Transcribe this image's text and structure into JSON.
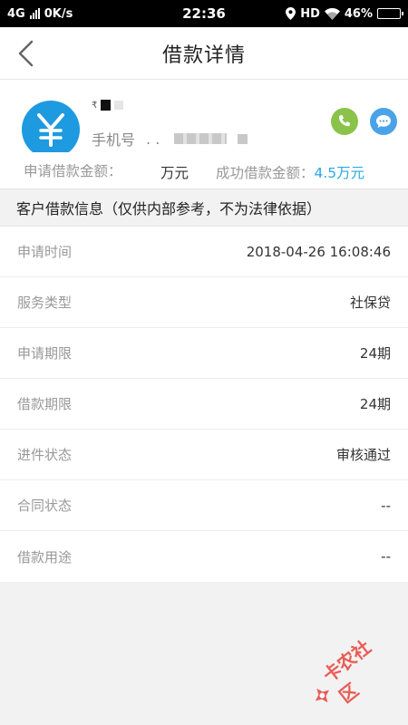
{
  "status": {
    "network": "4G",
    "speed": "0K/s",
    "time": "22:36",
    "hd": "HD",
    "battery": "46%"
  },
  "nav": {
    "title": "借款详情"
  },
  "profile": {
    "name_visible": "₹",
    "phone_label": "手机号",
    "phone_dots": ". ."
  },
  "amounts": {
    "applied_label": "申请借款金额：",
    "applied_value": "万元",
    "success_label": "成功借款金额：",
    "success_value": "4.5万元"
  },
  "section": {
    "title": "客户借款信息（仅供内部参考，不为法律依据）"
  },
  "info_rows": [
    {
      "label": "申请时间",
      "value": "2018-04-26 16:08:46"
    },
    {
      "label": "服务类型",
      "value": "社保贷"
    },
    {
      "label": "申请期限",
      "value": "24期"
    },
    {
      "label": "借款期限",
      "value": "24期"
    },
    {
      "label": "进件状态",
      "value": "审核通过"
    },
    {
      "label": "合同状态",
      "value": "--"
    },
    {
      "label": "借款用途",
      "value": "--"
    }
  ],
  "watermark": {
    "text": "卡农社区"
  },
  "colors": {
    "avatar": "#1e9ae0",
    "call": "#8bc34a",
    "message": "#4aa3e8",
    "success_amount": "#2aa8e6",
    "watermark": "#e8423a"
  }
}
